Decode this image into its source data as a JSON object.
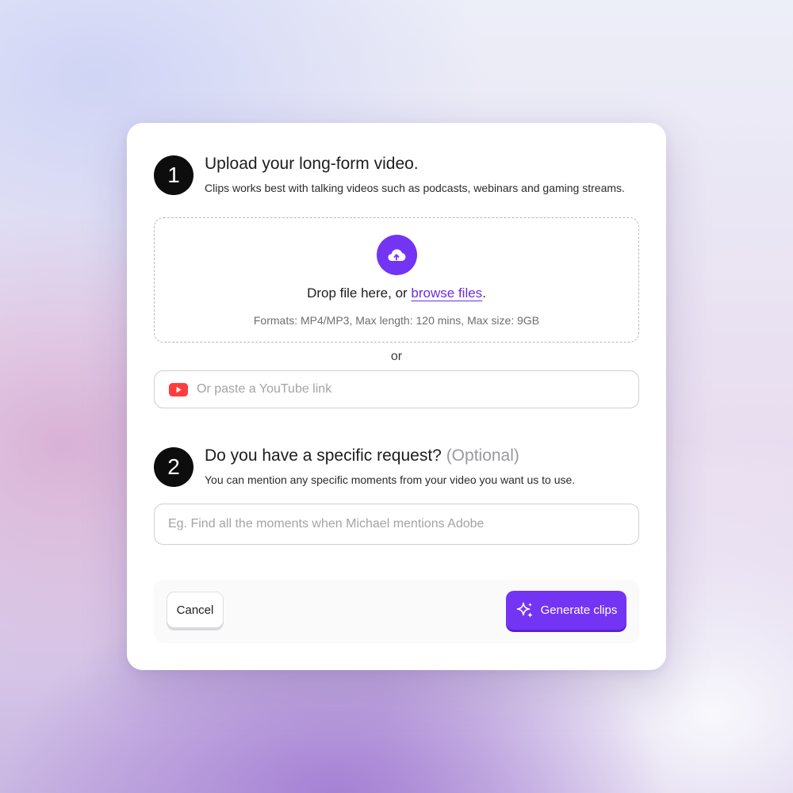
{
  "step1": {
    "number": "1",
    "title": "Upload your long-form video.",
    "description": "Clips works best with talking videos such as podcasts, webinars and gaming streams."
  },
  "dropzone": {
    "text_before": "Drop file here, or ",
    "link": "browse files",
    "text_after": ".",
    "formats": "Formats: MP4/MP3, Max length: 120 mins, Max size: 9GB"
  },
  "divider": "or",
  "youtube_input": {
    "placeholder": "Or paste a YouTube link"
  },
  "step2": {
    "number": "2",
    "title": "Do you have a specific request?",
    "optional": "(Optional)",
    "description": "You can mention any specific moments from your video you want us to use."
  },
  "request_input": {
    "placeholder": "Eg. Find all the moments when Michael mentions Adobe"
  },
  "footer": {
    "cancel_label": "Cancel",
    "generate_label": "Generate clips"
  },
  "icons": {
    "upload": "cloud-upload-icon",
    "youtube": "youtube-icon",
    "generate": "sparkles-icon"
  },
  "colors": {
    "accent": "#7434f3",
    "youtube": "#ff3d3d",
    "link": "#6c2ee0"
  }
}
